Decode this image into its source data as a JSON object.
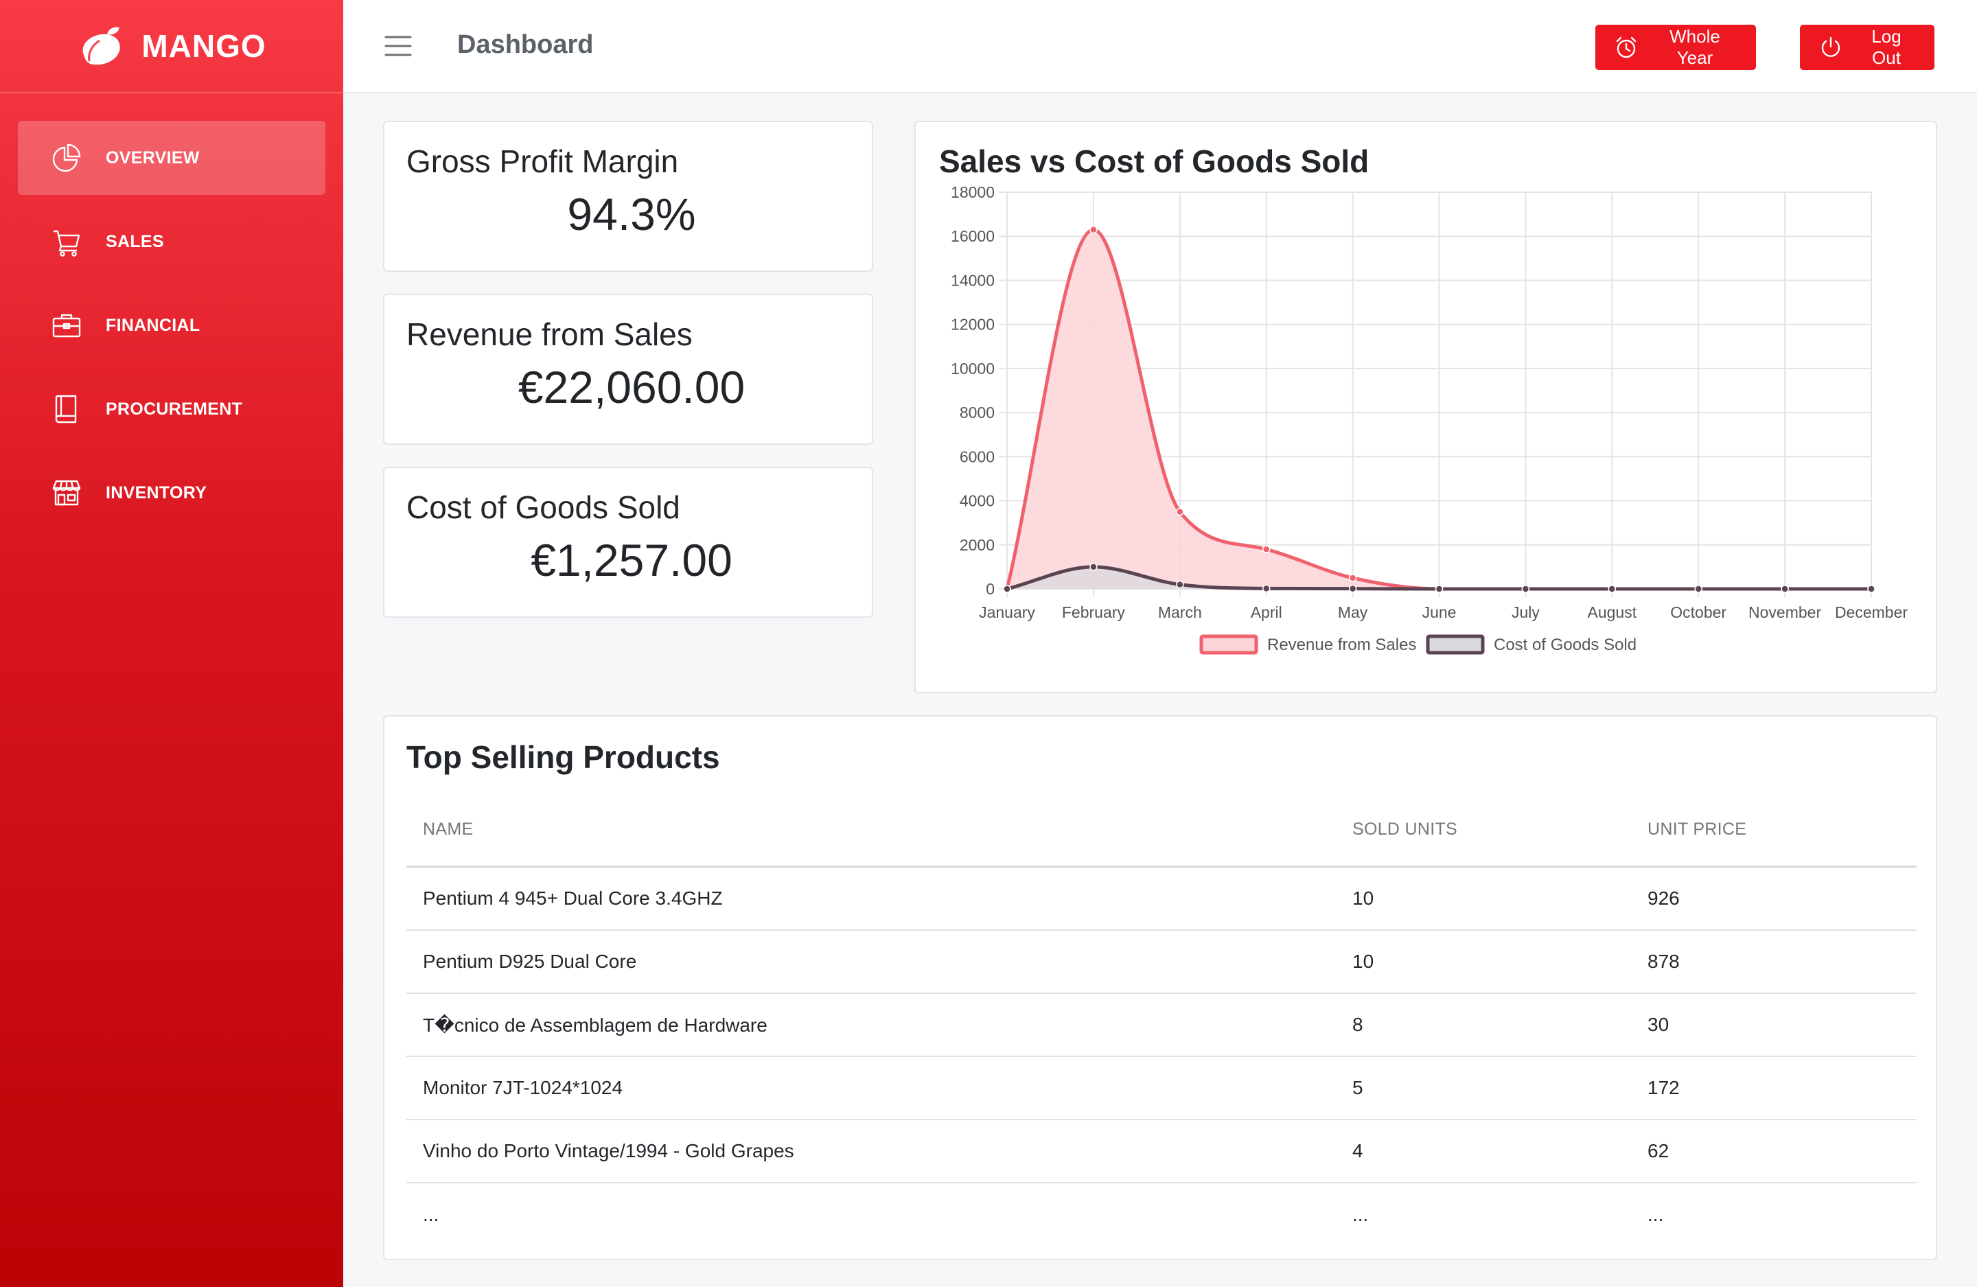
{
  "brand": {
    "name": "MANGO"
  },
  "sidebar": {
    "items": [
      {
        "label": "OVERVIEW",
        "icon": "pie-chart-icon",
        "active": true
      },
      {
        "label": "SALES",
        "icon": "cart-icon"
      },
      {
        "label": "FINANCIAL",
        "icon": "briefcase-icon"
      },
      {
        "label": "PROCUREMENT",
        "icon": "book-icon"
      },
      {
        "label": "INVENTORY",
        "icon": "store-icon"
      }
    ]
  },
  "header": {
    "title": "Dashboard",
    "period_label": "Whole Year",
    "logout_label": "Log Out"
  },
  "kpis": {
    "gross_margin": {
      "title": "Gross Profit Margin",
      "value": "94.3%"
    },
    "revenue": {
      "title": "Revenue from Sales",
      "value": "€22,060.00"
    },
    "cogs": {
      "title": "Cost of Goods Sold",
      "value": "€1,257.00"
    }
  },
  "colors": {
    "accent": "#ee1822",
    "revenue_line": "#f0616e",
    "revenue_fill": "#fbd4d8",
    "cogs_line": "#5b4452",
    "cogs_fill": "#d9d9de"
  },
  "chart_data": {
    "type": "area",
    "title": "Sales vs Cost of Goods Sold",
    "categories": [
      "January",
      "February",
      "March",
      "April",
      "May",
      "June",
      "July",
      "August",
      "October",
      "November",
      "December"
    ],
    "series": [
      {
        "name": "Revenue from Sales",
        "values": [
          0,
          16300,
          3500,
          1800,
          500,
          0,
          0,
          0,
          0,
          0,
          0
        ]
      },
      {
        "name": "Cost of Goods Sold",
        "values": [
          0,
          1000,
          200,
          20,
          10,
          0,
          0,
          0,
          0,
          0,
          0
        ]
      }
    ],
    "ylim": [
      0,
      18000
    ],
    "yticks": [
      0,
      2000,
      4000,
      6000,
      8000,
      10000,
      12000,
      14000,
      16000,
      18000
    ],
    "grid": true,
    "legend": "bottom"
  },
  "products": {
    "title": "Top Selling Products",
    "columns": [
      "NAME",
      "SOLD UNITS",
      "UNIT PRICE"
    ],
    "rows": [
      [
        "Pentium 4 945+ Dual Core 3.4GHZ",
        "10",
        "926"
      ],
      [
        "Pentium D925 Dual Core",
        "10",
        "878"
      ],
      [
        "T�cnico de Assemblagem de Hardware",
        "8",
        "30"
      ],
      [
        "Monitor 7JT-1024*1024",
        "5",
        "172"
      ],
      [
        "Vinho do Porto Vintage/1994 - Gold Grapes",
        "4",
        "62"
      ],
      [
        "...",
        "...",
        "..."
      ]
    ]
  }
}
